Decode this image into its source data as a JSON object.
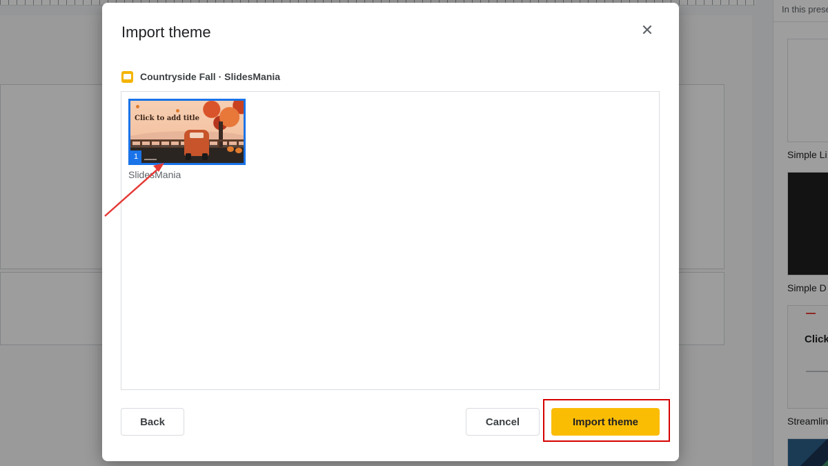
{
  "background": {
    "right_panel_header": "In this prese",
    "themes": [
      "Simple Li",
      "Simple D",
      "Streamlin"
    ],
    "streamline_preview_title": "Click"
  },
  "dialog": {
    "title": "Import theme",
    "close_icon": "close-icon",
    "source_icon": "google-slides-icon",
    "source_name": "Countryside Fall · SlidesMania",
    "theme": {
      "preview_title": "Click to add title",
      "slide_number": "1",
      "label": "SlidesMania"
    },
    "buttons": {
      "back": "Back",
      "cancel": "Cancel",
      "import": "Import theme"
    }
  },
  "colors": {
    "accent_blue": "#1a73e8",
    "import_yellow": "#fbbc04",
    "annotation_red": "#d50000"
  }
}
